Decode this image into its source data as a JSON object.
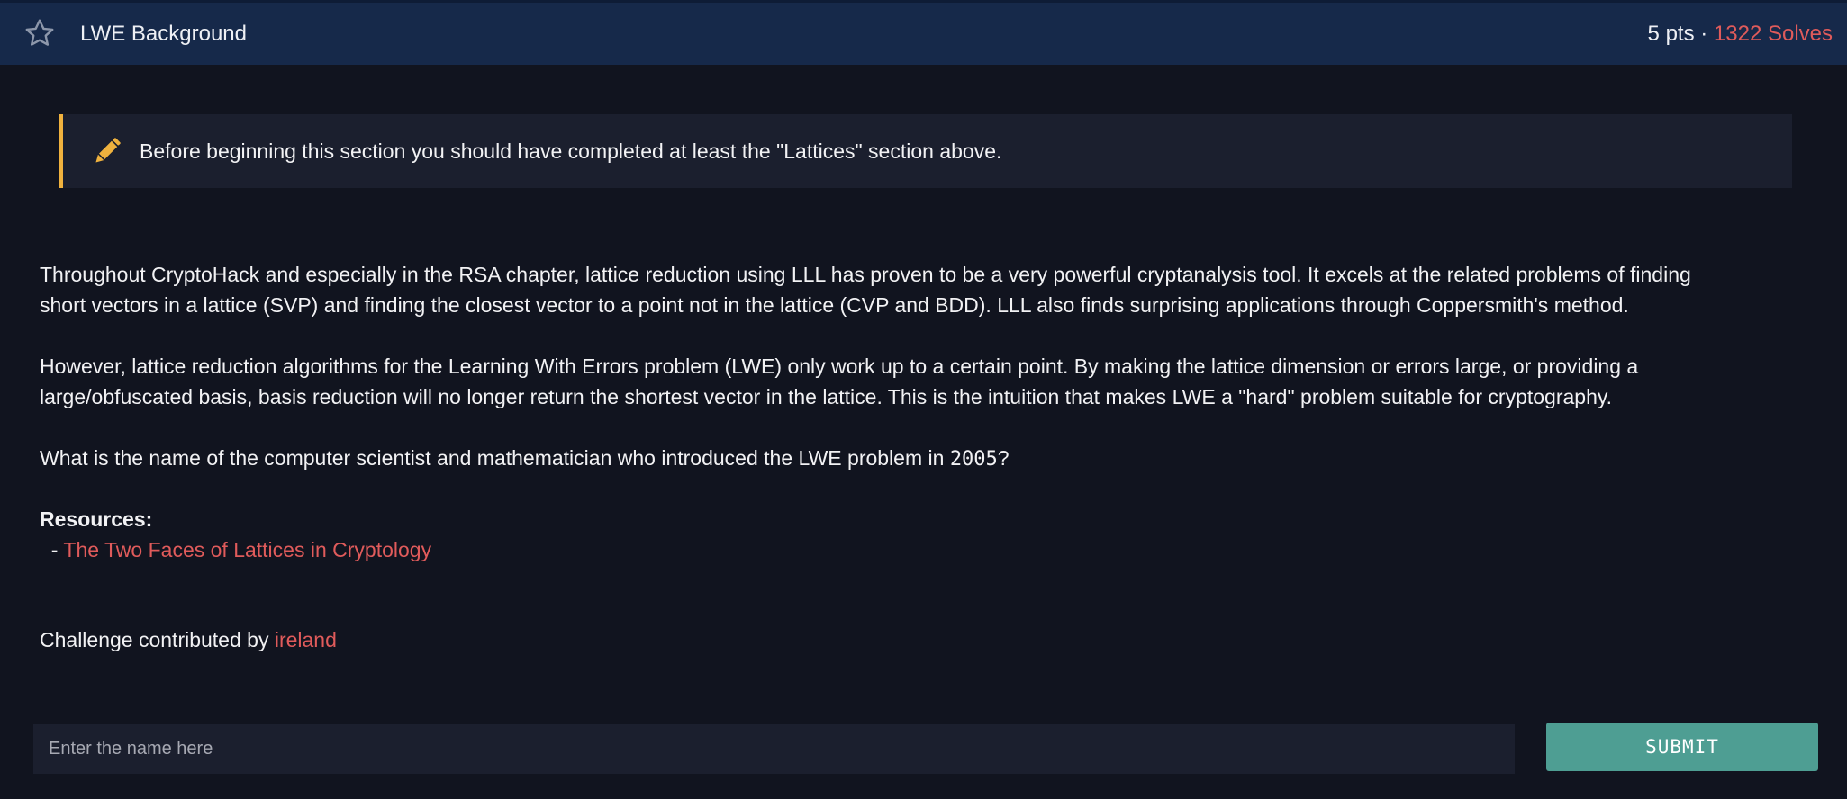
{
  "header": {
    "title": "LWE Background",
    "points": "5 pts",
    "separator": " · ",
    "solves": "1322 Solves",
    "star_icon": "star-outline-icon"
  },
  "notice": {
    "icon": "pencil-icon",
    "text": "Before beginning this section you should have completed at least the \"Lattices\" section above."
  },
  "content": {
    "para1_line1": "Throughout CryptoHack and especially in the RSA chapter, lattice reduction using LLL has proven to be a very powerful cryptanalysis tool. It excels at the related problems of finding",
    "para1_line2": "short vectors in a lattice (SVP) and finding the closest vector to a point not in the lattice (CVP and BDD). LLL also finds surprising applications through Coppersmith's method.",
    "para2_line1": "However, lattice reduction algorithms for the Learning With Errors problem (LWE) only work up to a certain point. By making the lattice dimension or errors large, or providing a",
    "para2_line2": "large/obfuscated basis, basis reduction will no longer return the shortest vector in the lattice. This is the intuition that makes LWE a \"hard\" problem suitable for cryptography.",
    "question_before": "What is the name of the computer scientist and mathematician who introduced the LWE problem in ",
    "question_year": "2005",
    "question_after": "?",
    "resources_heading": "Resources:",
    "resource_bullet": "- ",
    "resource_link": "The Two Faces of Lattices in Cryptology",
    "contributed_text": "Challenge contributed by ",
    "contributor": "ireland"
  },
  "form": {
    "placeholder": "Enter the name here",
    "value": "",
    "submit_label": "SUBMIT"
  },
  "colors": {
    "background": "#11141f",
    "header": "#16294a",
    "accent_red": "#e05b5b",
    "notice_border": "#f0b23e",
    "submit": "#4e9e93"
  }
}
